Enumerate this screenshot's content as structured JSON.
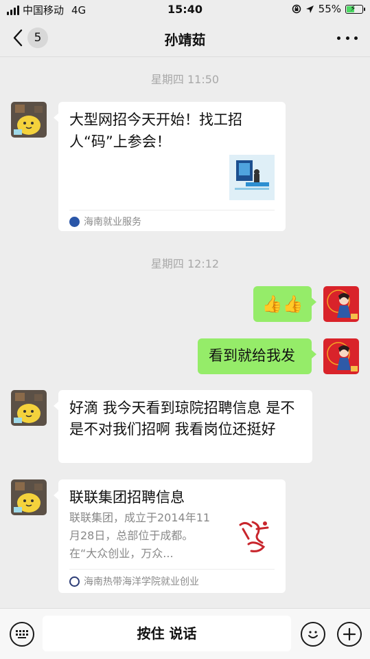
{
  "status": {
    "carrier": "中国移动",
    "network": "4G",
    "time": "15:40",
    "battery": "55%",
    "battery_level": 0.55,
    "icons": [
      "lock-rotation-icon",
      "location-arrow-icon",
      "battery-charging-icon"
    ]
  },
  "nav": {
    "unread_count": "5",
    "title": "孙靖茹",
    "icons": [
      "back-chevron-icon",
      "more-dots-icon"
    ]
  },
  "messages": [
    {
      "type": "timestamp",
      "text": "星期四 11:50"
    },
    {
      "type": "article",
      "side": "left",
      "title": "大型网招今天开始！找工招人“码”上参会！",
      "source": "海南就业服务"
    },
    {
      "type": "timestamp",
      "text": "星期四 12:12"
    },
    {
      "type": "text",
      "side": "right",
      "text": "👍👍"
    },
    {
      "type": "text",
      "side": "right",
      "text": "看到就给我发"
    },
    {
      "type": "text",
      "side": "left",
      "text": "好滴  我今天看到琼院招聘信息  是不是不对我们招啊  我看岗位还挺好"
    },
    {
      "type": "article",
      "side": "left",
      "title": "联联集团招聘信息",
      "desc": "联联集团，成立于2014年11月28日，总部位于成都。在“大众创业，万众...",
      "source": "海南热带海洋学院就业创业"
    }
  ],
  "inputbar": {
    "hold_to_talk": "按住 说话",
    "icons": [
      "keyboard-icon",
      "emoji-icon",
      "plus-icon"
    ]
  },
  "colors": {
    "background": "#ededed",
    "self_bubble": "#95ec69",
    "other_bubble": "#ffffff",
    "timestamp": "#a8a8a8"
  }
}
